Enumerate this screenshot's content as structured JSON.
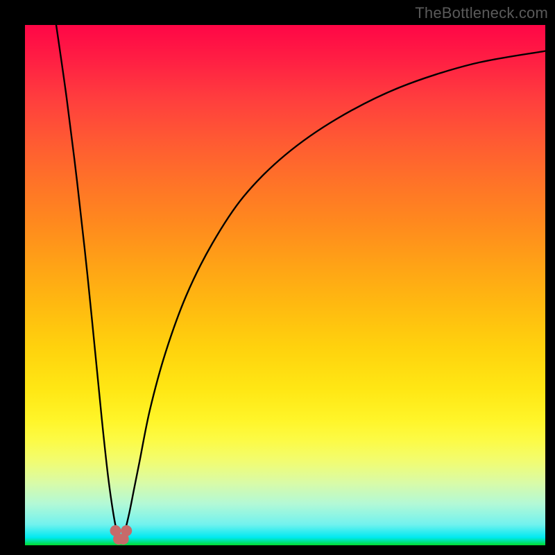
{
  "watermark": {
    "text": "TheBottleneck.com"
  },
  "chart_data": {
    "type": "line",
    "title": "",
    "xlabel": "",
    "ylabel": "",
    "xlim": [
      0,
      100
    ],
    "ylim": [
      0,
      100
    ],
    "notes": "Background is a vertical spectral gradient from red (top ≈ 100) to green (bottom ≈ 0). Curve appears to show deviation/bottleneck magnitude — minimum near x ≈ 18.",
    "series": [
      {
        "name": "bottleneck-curve",
        "x": [
          6,
          8,
          10,
          12,
          14,
          15,
          16,
          17,
          17.8,
          18.4,
          19,
          20,
          21,
          22,
          24,
          27,
          31,
          36,
          42,
          50,
          60,
          72,
          86,
          100
        ],
        "y": [
          100,
          86,
          70,
          52,
          32,
          22,
          13,
          6,
          2,
          0.5,
          2,
          6,
          11,
          16,
          26,
          37,
          48,
          58,
          67,
          75,
          82,
          88,
          92.5,
          95
        ]
      }
    ],
    "markers": [
      {
        "name": "valley-dot-left",
        "x": 17.4,
        "y": 2.8
      },
      {
        "name": "valley-dot-mid-l",
        "x": 18.0,
        "y": 1.2
      },
      {
        "name": "valley-dot-mid-r",
        "x": 18.9,
        "y": 1.2
      },
      {
        "name": "valley-dot-right",
        "x": 19.5,
        "y": 2.8
      }
    ],
    "colors": {
      "curve": "#000000",
      "marker": "#c76a6a",
      "gradient_top": "#ff0646",
      "gradient_bottom": "#00dd2f"
    }
  }
}
